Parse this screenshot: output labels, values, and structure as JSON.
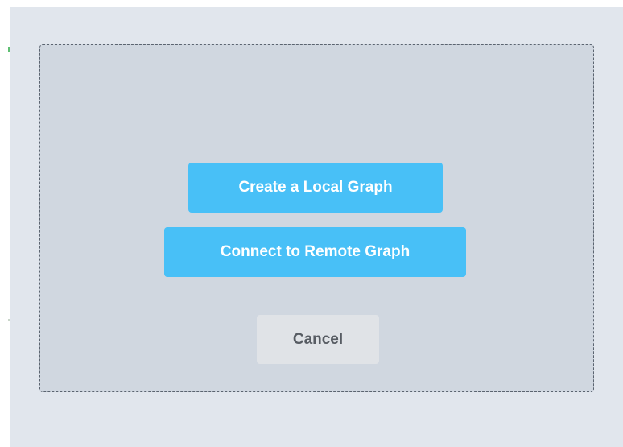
{
  "dialog": {
    "buttons": {
      "create_local_label": "Create a Local Graph",
      "connect_remote_label": "Connect to Remote Graph",
      "cancel_label": "Cancel"
    }
  },
  "colors": {
    "backdrop": "#e1e6ed",
    "dialog_background": "#d0d7e0",
    "primary_button": "#48c0f7",
    "primary_button_text": "#ffffff",
    "cancel_button": "#e0e3e7",
    "cancel_button_text": "#575c63",
    "dialog_border": "#5b6470"
  }
}
